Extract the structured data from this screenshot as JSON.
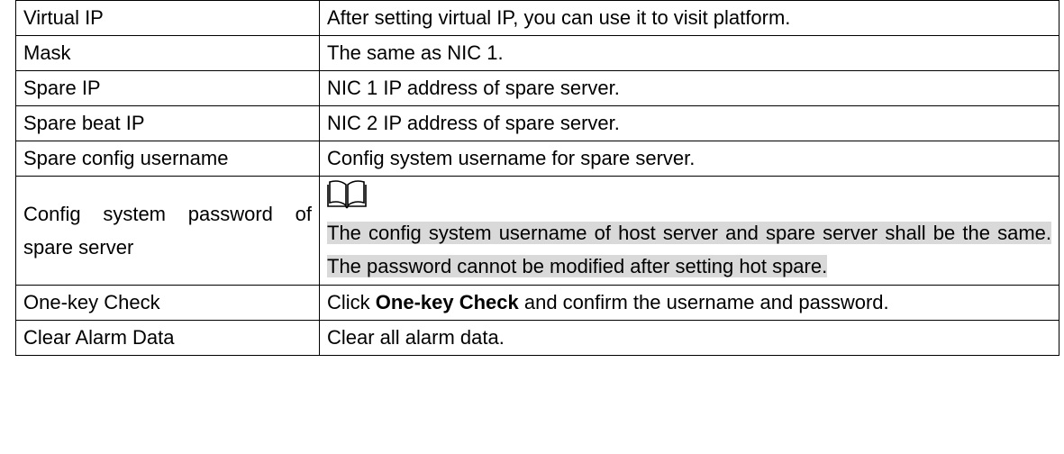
{
  "rows": [
    {
      "param": "Virtual IP",
      "desc": "After setting virtual IP, you can use it to visit platform."
    },
    {
      "param": "Mask",
      "desc": "The same as NIC 1."
    },
    {
      "param": "Spare IP",
      "desc": "NIC 1 IP address of spare server."
    },
    {
      "param": "Spare beat IP",
      "desc": "NIC 2 IP address of spare server."
    },
    {
      "param": "Spare config username",
      "desc": "Config system username for spare server."
    },
    {
      "param": "Config system password of spare server",
      "note_icon": "book-note-icon",
      "note": "The config system username of host server and spare server shall be the same. The password cannot be modified after setting hot spare."
    },
    {
      "param": "One-key Check",
      "desc_bold": "One-key Check",
      "desc_prefix": "Click ",
      "desc_suffix": " and confirm the username and password."
    },
    {
      "param": "Clear Alarm Data",
      "desc": "Clear all alarm data."
    }
  ],
  "colors": {
    "border": "#000000",
    "note_highlight": "#d9d9d9"
  }
}
